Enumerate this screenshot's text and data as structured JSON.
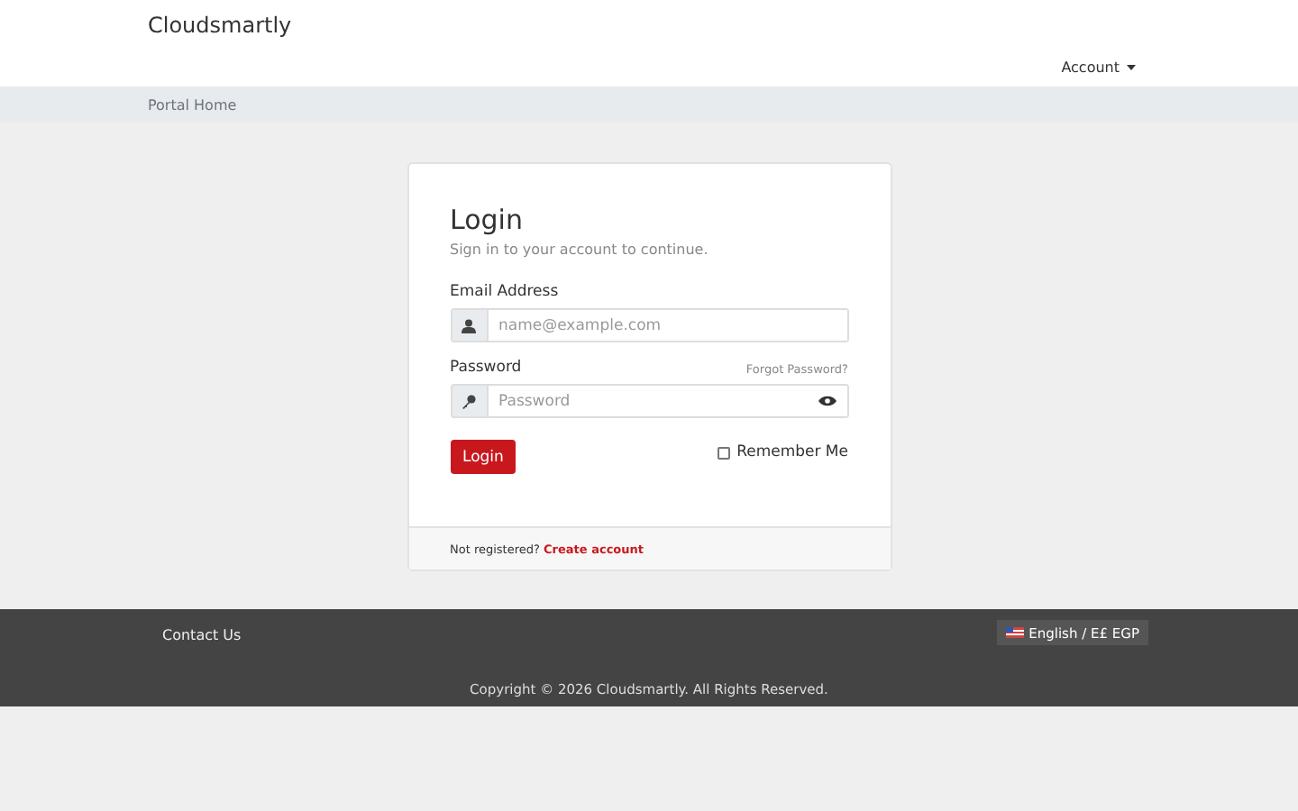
{
  "header": {
    "brand": "Cloudsmartly",
    "account_menu": "Account"
  },
  "breadcrumb": [
    "Portal Home"
  ],
  "login": {
    "title": "Login",
    "subtitle": "Sign in to your account to continue.",
    "email": {
      "label": "Email Address",
      "placeholder": "name@example.com"
    },
    "password": {
      "label": "Password",
      "placeholder": "Password",
      "forgot_link": "Forgot Password?"
    },
    "submit": "Login",
    "remember_me": {
      "label": "Remember Me",
      "checked": false
    },
    "footer_text": "Not registered?",
    "footer_link": "Create account"
  },
  "footer": {
    "contact": "Contact Us",
    "language": "English / E£ EGP",
    "copyright": "Copyright © 2026 Cloudsmartly. All Rights Reserved."
  }
}
